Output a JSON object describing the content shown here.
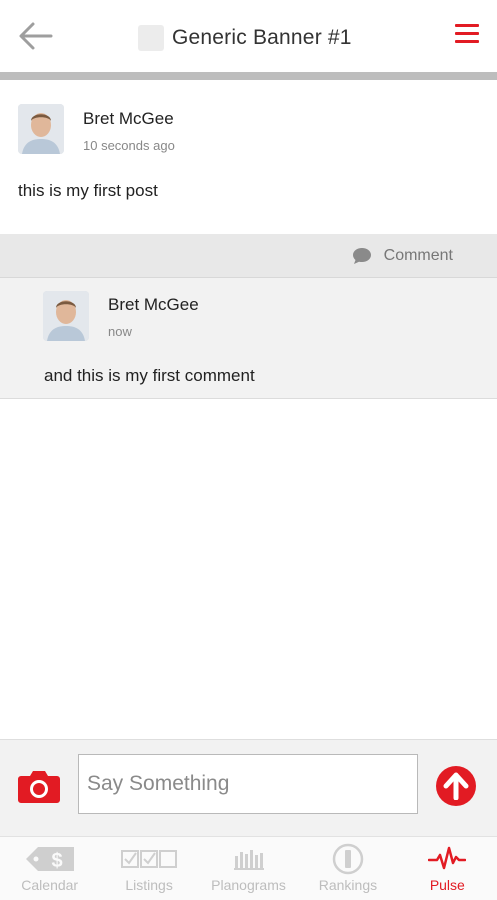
{
  "header": {
    "title": "Generic Banner #1"
  },
  "post": {
    "author": "Bret McGee",
    "timestamp": "10 seconds ago",
    "text": "this is my first post"
  },
  "comment_bar": {
    "label": "Comment"
  },
  "comment": {
    "author": "Bret McGee",
    "timestamp": "now",
    "text": "and this is my first comment"
  },
  "composer": {
    "placeholder": "Say Something",
    "value": ""
  },
  "nav": {
    "items": [
      {
        "label": "Calendar",
        "icon": "calendar-tag-icon",
        "active": false
      },
      {
        "label": "Listings",
        "icon": "checkbox-list-icon",
        "active": false
      },
      {
        "label": "Planograms",
        "icon": "shelf-bars-icon",
        "active": false
      },
      {
        "label": "Rankings",
        "icon": "rank-circle-icon",
        "active": false
      },
      {
        "label": "Pulse",
        "icon": "pulse-icon",
        "active": true
      }
    ]
  },
  "colors": {
    "accent": "#e21b23",
    "inactive": "#bdbdbd"
  }
}
